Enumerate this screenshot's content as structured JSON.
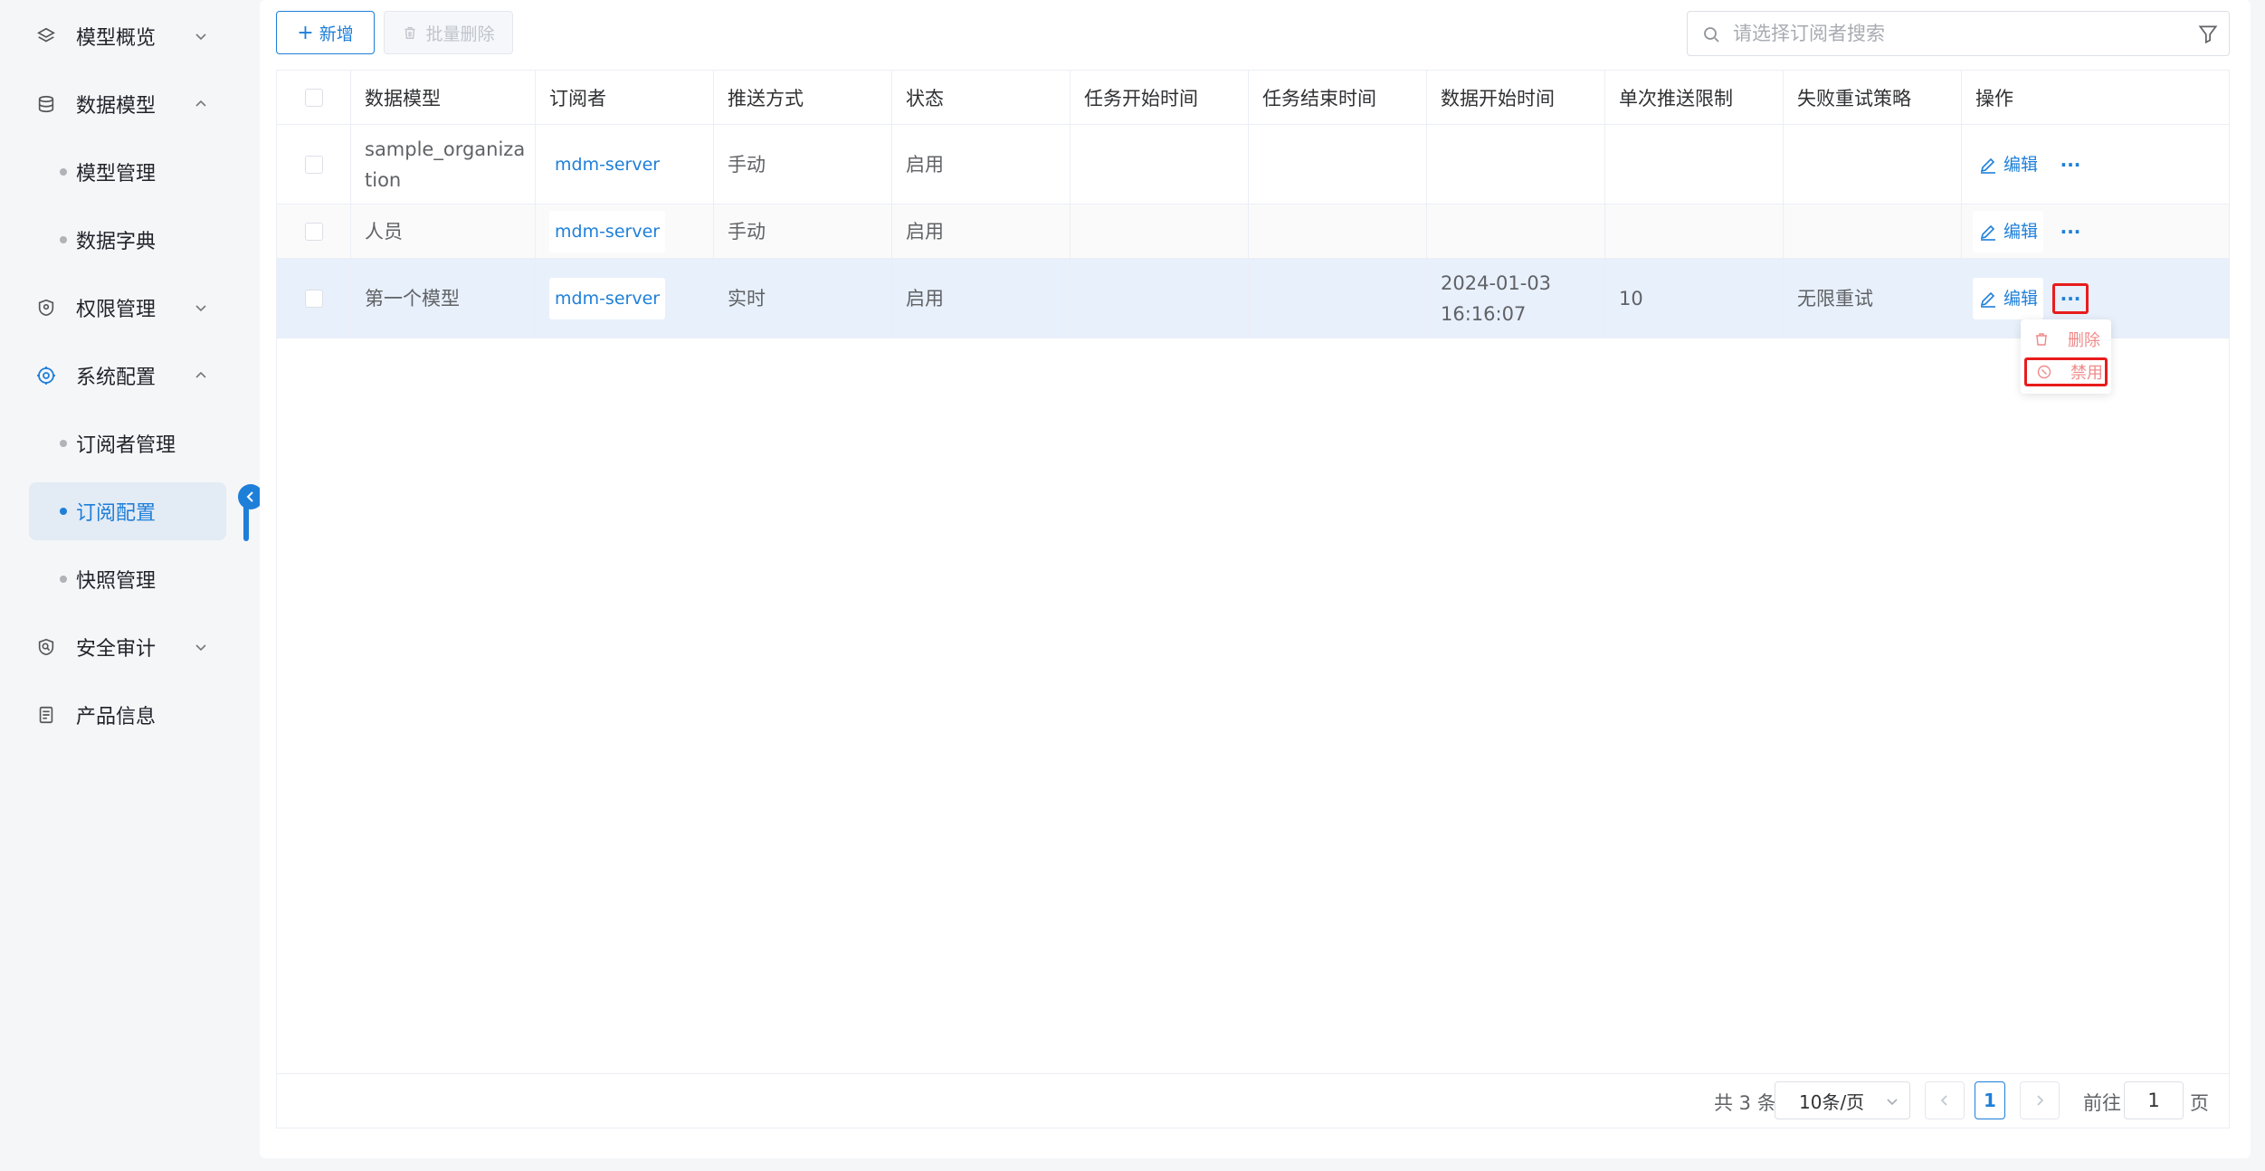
{
  "sidebar": {
    "items": [
      {
        "label": "模型概览",
        "icon": "layers-icon",
        "expanded": false
      },
      {
        "label": "数据模型",
        "icon": "database-icon",
        "expanded": true,
        "children": [
          {
            "label": "模型管理"
          },
          {
            "label": "数据字典"
          }
        ]
      },
      {
        "label": "权限管理",
        "icon": "shield-icon",
        "expanded": false
      },
      {
        "label": "系统配置",
        "icon": "settings-icon",
        "expanded": true,
        "children": [
          {
            "label": "订阅者管理"
          },
          {
            "label": "订阅配置",
            "active": true
          },
          {
            "label": "快照管理"
          }
        ]
      },
      {
        "label": "安全审计",
        "icon": "audit-shield-icon",
        "expanded": false
      },
      {
        "label": "产品信息",
        "icon": "document-icon",
        "expanded": false
      }
    ]
  },
  "toolbar": {
    "add_label": "新增",
    "batch_delete_label": "批量删除",
    "search_placeholder": "请选择订阅者搜索"
  },
  "table": {
    "columns": [
      "数据模型",
      "订阅者",
      "推送方式",
      "状态",
      "任务开始时间",
      "任务结束时间",
      "数据开始时间",
      "单次推送限制",
      "失败重试策略",
      "操作"
    ],
    "rows": [
      {
        "model": "sample_organization",
        "subscriber": "mdm-server",
        "push": "手动",
        "status": "启用",
        "task_start": "",
        "task_end": "",
        "data_start": "",
        "limit": "",
        "retry": "",
        "edit": "编辑"
      },
      {
        "model": "人员",
        "subscriber": "mdm-server",
        "push": "手动",
        "status": "启用",
        "task_start": "",
        "task_end": "",
        "data_start": "",
        "limit": "",
        "retry": "",
        "edit": "编辑"
      },
      {
        "model": "第一个模型",
        "subscriber": "mdm-server",
        "push": "实时",
        "status": "启用",
        "task_start": "",
        "task_end": "",
        "data_start": "2024-01-03 16:16:07",
        "limit": "10",
        "retry": "无限重试",
        "edit": "编辑"
      }
    ]
  },
  "dropdown": {
    "items": [
      {
        "label": "删除",
        "icon": "trash-icon"
      },
      {
        "label": "禁用",
        "icon": "disable-icon"
      }
    ]
  },
  "pagination": {
    "total_text": "共 3 条",
    "page_size": "10条/页",
    "current_page": "1",
    "goto_label": "前往",
    "goto_value": "1",
    "page_unit": "页"
  },
  "colors": {
    "accent": "#1e7fd9",
    "highlight_row": "#e8f0fb",
    "annotation_red": "#e81c1c"
  }
}
